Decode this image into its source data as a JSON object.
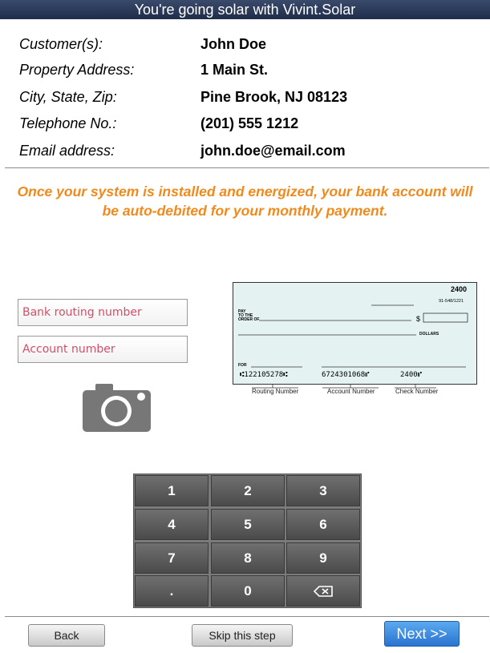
{
  "header": {
    "title": "You're going solar with Vivint.Solar"
  },
  "customer_info": {
    "rows": [
      {
        "label": "Customer(s):",
        "value": "John Doe"
      },
      {
        "label": "Property Address:",
        "value": "1 Main St."
      },
      {
        "label": "City, State, Zip:",
        "value": "Pine Brook, NJ 08123"
      },
      {
        "label": "Telephone No.:",
        "value": "(201) 555 1212"
      },
      {
        "label": "Email address:",
        "value": "john.doe@email.com"
      }
    ]
  },
  "notice": {
    "text": "Once your system is installed and energized, your bank account will be auto-debited for your monthly payment."
  },
  "form": {
    "routing_placeholder": "Bank routing number",
    "account_placeholder": "Account number",
    "camera_icon": "camera-icon"
  },
  "check_image": {
    "check_number": "2400",
    "fraction": "91-548/1221",
    "pay_to_label": "PAY\nTO THE\nORDER OF",
    "dollar_sign": "$",
    "dollars_label": "DOLLARS",
    "for_label": "FOR",
    "micr_routing": "⑆122105278⑆",
    "micr_account": "6724301068⑈",
    "micr_check": "2400⑈",
    "annotations": {
      "routing": "Routing Number",
      "account": "Account Number",
      "check": "Check Number"
    }
  },
  "keypad": {
    "keys": [
      "1",
      "2",
      "3",
      "4",
      "5",
      "6",
      "7",
      "8",
      "9",
      ".",
      "0",
      "⌫"
    ]
  },
  "footer": {
    "back_label": "Back",
    "skip_label": "Skip this step",
    "next_label": "Next >>"
  },
  "colors": {
    "title_bar": "#1f2d4a",
    "notice_text": "#f08a1c",
    "placeholder_text": "#d0506a",
    "next_button": "#2a74d0"
  }
}
